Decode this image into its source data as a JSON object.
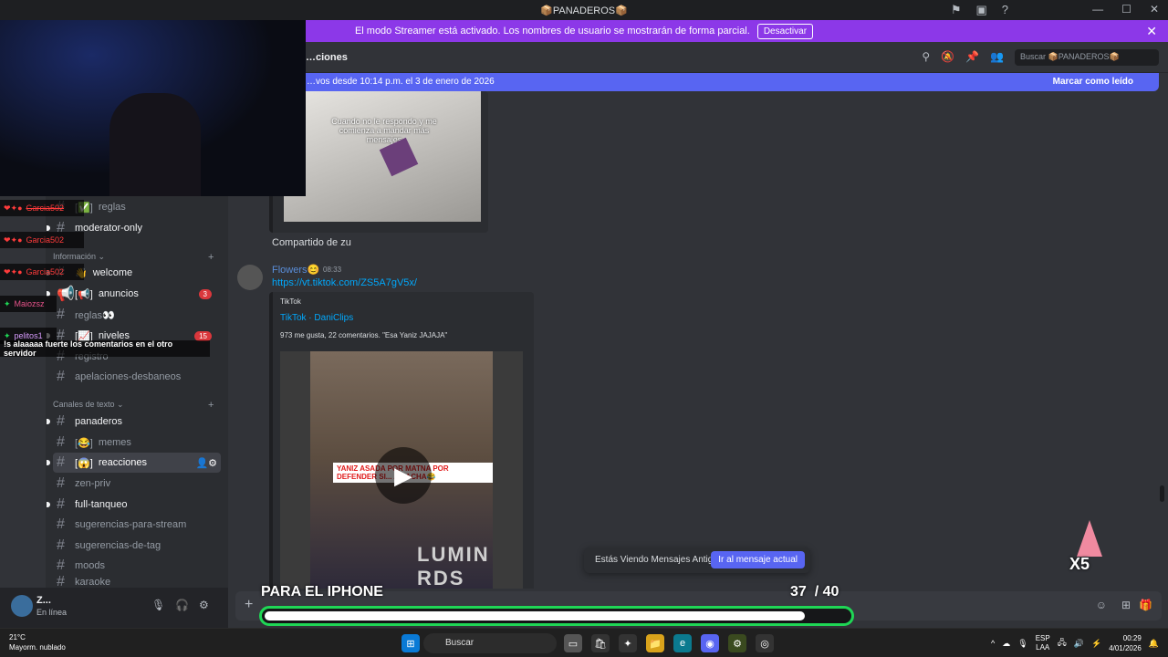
{
  "titlebar": {
    "title": "📦PANADEROS📦"
  },
  "streamer_banner": {
    "text": "El modo Streamer está activado. Los nombres de usuario se mostrarán de forma parcial.",
    "button": "Desactivar"
  },
  "header": {
    "channel_name": "…ciones",
    "search_placeholder": "Buscar 📦PANADEROS📦"
  },
  "new_messages_bar": {
    "text": "…vos desde 10:14 p.m. el 3 de enero de 2026",
    "mark_read": "Marcar como leído"
  },
  "sidebar": {
    "top_channels": [
      {
        "name": "reglas",
        "prefix": "[✅]"
      },
      {
        "name": "moderator-only",
        "prefix": ""
      }
    ],
    "category_info": "Información",
    "info_channels": [
      {
        "name": "welcome",
        "prefix": "👋"
      },
      {
        "name": "anuncios",
        "prefix": "[📢]",
        "badge": "3"
      },
      {
        "name": "reglas👀",
        "prefix": ""
      },
      {
        "name": "niveles",
        "prefix": "[📈]",
        "badge": "15"
      },
      {
        "name": "registro",
        "prefix": ""
      },
      {
        "name": "apelaciones-desbaneos",
        "prefix": ""
      }
    ],
    "category_text": "Canales de texto",
    "text_channels": [
      {
        "name": "panaderos",
        "prefix": ""
      },
      {
        "name": "memes",
        "prefix": "[😂]"
      },
      {
        "name": "reacciones",
        "prefix": "[😱]"
      },
      {
        "name": "zen-priv",
        "prefix": ""
      },
      {
        "name": "full-tanqueo",
        "prefix": ""
      },
      {
        "name": "sugerencias-para-stream",
        "prefix": ""
      },
      {
        "name": "sugerencias-de-tag",
        "prefix": ""
      },
      {
        "name": "moods",
        "prefix": ""
      },
      {
        "name": "karaoke",
        "prefix": ""
      }
    ]
  },
  "user_panel": {
    "name": "Z...",
    "status": "En línea"
  },
  "messages": {
    "video1_caption": "Cuando no le respondo y me comienza a mandar más mensajes",
    "shared_text": "Compartido de zu",
    "author": "Flowers😊",
    "time": "08:33",
    "link": "https://vt.tiktok.com/ZS5A7gV5x/",
    "embed_provider": "TikTok",
    "embed_title": "TikTok · DaniClips",
    "embed_desc": "973 me gusta, 22 comentarios. \"Esa Yaniz JAJAJA\"",
    "video2_caption": "YANIZ ASADA POR MATNA POR DEFENDER SI... A SACHA😂",
    "video2_banner": "LUMIN RDS"
  },
  "old_messages_pill": {
    "text": "Estás Viendo Mensajes Antiguos",
    "button": "Ir al mensaje actual"
  },
  "stream_overlay": {
    "chat": [
      {
        "user": "Garcia502"
      },
      {
        "user": "Garcia502"
      },
      {
        "user": "Garcia502"
      },
      {
        "user": "Maiozsz"
      },
      {
        "user": "pelitos1",
        "message": "!s alaaaaa fuerte los comentarios en el otro servidor"
      }
    ],
    "goal_label": "PARA EL IPHONE",
    "goal_current": "37",
    "goal_total": "/ 40",
    "goal_progress": 0.925,
    "sticker_text": "X5"
  },
  "taskbar": {
    "weather_temp": "21°C",
    "weather_desc": "Mayorm. nublado",
    "search": "Buscar",
    "lang": "ESP",
    "lang2": "LAA",
    "time": "00:29",
    "date": "4/01/2026"
  },
  "colors": {
    "accent": "#5865f2",
    "streamer": "#8c38e8",
    "goal": "#1fd655"
  }
}
